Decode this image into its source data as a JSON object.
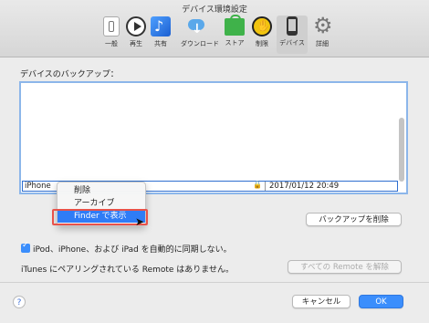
{
  "window": {
    "title": "デバイス環境設定"
  },
  "toolbar": {
    "items": [
      {
        "label": "一般",
        "icon": "general-icon"
      },
      {
        "label": "再生",
        "icon": "play-icon"
      },
      {
        "label": "共有",
        "icon": "share-music-icon"
      },
      {
        "label": "ダウンロード",
        "icon": "download-cloud-icon"
      },
      {
        "label": "ストア",
        "icon": "store-bag-icon"
      },
      {
        "label": "制限",
        "icon": "restriction-hand-icon"
      },
      {
        "label": "デバイス",
        "icon": "iphone-icon",
        "active": true
      },
      {
        "label": "詳細",
        "icon": "gear-icon"
      }
    ]
  },
  "backup": {
    "section_label": "デバイスのバックアップ：",
    "rows": [
      {
        "name": "iPhone",
        "date": "2017/01/12 20:49",
        "locked": true
      }
    ],
    "delete_button": "バックアップを削除"
  },
  "context_menu": {
    "items": [
      "削除",
      "アーカイブ",
      "Finder で表示"
    ],
    "highlighted_index": 2
  },
  "options": {
    "sync_checkbox_label": "iPod、iPhone、および iPad を自動的に同期しない。",
    "sync_checked": true,
    "remote_text": "iTunes にペアリングされている Remote はありません。",
    "unpair_button": "すべての Remote を解除"
  },
  "footer": {
    "help_label": "?",
    "cancel_button": "キャンセル",
    "ok_button": "OK"
  },
  "colors": {
    "accent": "#3b8efc",
    "selection_outline": "#2f6fd0",
    "annotation_red": "#e8524a"
  }
}
